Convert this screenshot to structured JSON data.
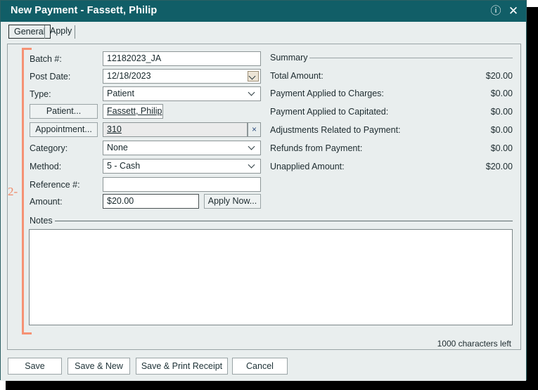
{
  "window": {
    "title": "New Payment - Fassett, Philip",
    "help_icon": "help-circle-icon",
    "close_icon": "close-icon",
    "titlebar_color": "#115e67",
    "background_color": "#e9eeee"
  },
  "tabs": [
    {
      "label": "General",
      "active": true
    },
    {
      "label": "Apply",
      "active": false
    }
  ],
  "annotation": {
    "number": "2-",
    "color": "#f59274"
  },
  "form": {
    "batch": {
      "label": "Batch #:",
      "value": "12182023_JA",
      "placeholder": ""
    },
    "post_date": {
      "label": "Post Date:",
      "value": "12/18/2023",
      "picker_icon": "chevron-down-icon"
    },
    "type": {
      "label": "Type:",
      "value": "Patient",
      "chevron": "chevron-down-icon"
    },
    "patient": {
      "button_label": "Patient...",
      "value": "Fassett, Philip "
    },
    "appointment": {
      "button_label": "Appointment...",
      "value": "310",
      "clear_icon": "×"
    },
    "category": {
      "label": "Category:",
      "value": "None",
      "chevron": "chevron-down-icon"
    },
    "method": {
      "label": "Method:",
      "value": "5 - Cash",
      "chevron": "chevron-down-icon"
    },
    "reference": {
      "label": "Reference #:",
      "value": "",
      "placeholder": ""
    },
    "amount": {
      "label": "Amount:",
      "value": "$20.00",
      "placeholder": ""
    },
    "apply_now_label": "Apply Now..."
  },
  "summary": {
    "title": "Summary",
    "rows": [
      {
        "label": "Total Amount:",
        "value": "$20.00"
      },
      {
        "label": "Payment Applied to Charges:",
        "value": "$0.00"
      },
      {
        "label": "Payment Applied to Capitated:",
        "value": "$0.00"
      },
      {
        "label": "Adjustments Related to Payment:",
        "value": "$0.00"
      },
      {
        "label": "Refunds from Payment:",
        "value": "$0.00"
      },
      {
        "label": "Unapplied Amount:",
        "value": "$20.00"
      }
    ]
  },
  "notes": {
    "title": "Notes",
    "value": "",
    "characters_left": "1000 characters left"
  },
  "footer": {
    "save": "Save",
    "save_new": "Save & New",
    "save_print": "Save & Print Receipt",
    "cancel": "Cancel"
  }
}
